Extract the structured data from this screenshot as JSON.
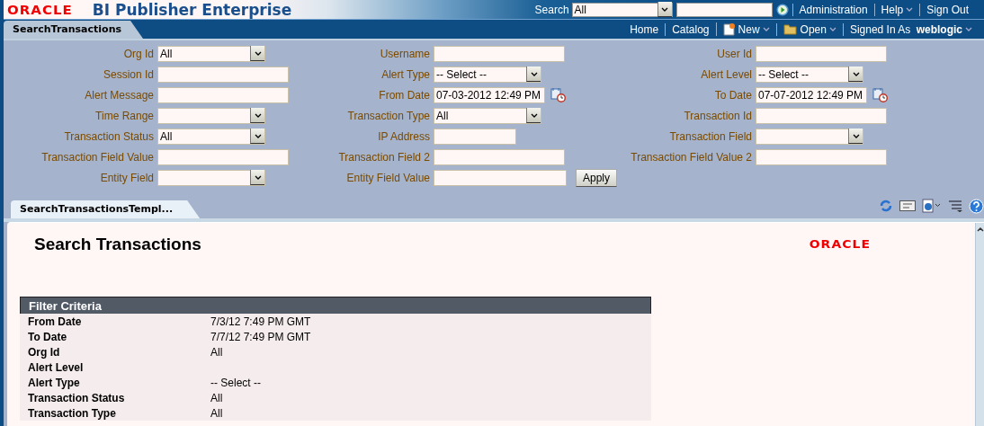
{
  "header": {
    "logo": "ORACLE",
    "product": "BI Publisher Enterprise",
    "search": {
      "label": "Search",
      "scope": "All"
    },
    "links": [
      {
        "label": "Administration",
        "menu": false
      },
      {
        "label": "Help",
        "menu": true
      },
      {
        "label": "Sign Out",
        "menu": false
      }
    ]
  },
  "nav": {
    "tab": {
      "label": "SearchTransactions",
      "selected": true
    },
    "links": [
      {
        "label": "Home",
        "kind": "link"
      },
      {
        "label": "Catalog",
        "kind": "link"
      },
      {
        "label": "New",
        "kind": "new"
      },
      {
        "label": "Open",
        "kind": "open"
      }
    ],
    "signed_in": {
      "label": "Signed In As",
      "user": "weblogic"
    }
  },
  "form": {
    "fields": [
      {
        "label": "Org Id",
        "kind": "select",
        "value": "All"
      },
      {
        "label": "Username",
        "kind": "text"
      },
      {
        "label": "User Id",
        "kind": "text"
      },
      {
        "label": "Session Id",
        "kind": "text"
      },
      {
        "label": "Alert Type",
        "kind": "select",
        "value": "-- Select --"
      },
      {
        "label": "Alert Level",
        "kind": "select",
        "value": "-- Select --"
      },
      {
        "label": "Alert Message",
        "kind": "text"
      },
      {
        "label": "From Date",
        "kind": "date",
        "value": "07-03-2012 12:49 PM"
      },
      {
        "label": "To Date",
        "kind": "date",
        "value": "07-07-2012 12:49 PM"
      },
      {
        "label": "Time Range",
        "kind": "select"
      },
      {
        "label": "Transaction Type",
        "kind": "select",
        "value": "All"
      },
      {
        "label": "Transaction Id",
        "kind": "text"
      },
      {
        "label": "Transaction Status",
        "kind": "select",
        "value": "All"
      },
      {
        "label": "IP Address",
        "kind": "short"
      },
      {
        "label": "Transaction Field",
        "kind": "select"
      },
      {
        "label": "Transaction Field Value",
        "kind": "text"
      },
      {
        "label": "Transaction Field 2",
        "kind": "text"
      },
      {
        "label": "Transaction Field Value 2",
        "kind": "text"
      },
      {
        "label": "Entity Field",
        "kind": "select"
      },
      {
        "label": "Entity Field Value",
        "kind": "text"
      }
    ],
    "apply": "Apply"
  },
  "report": {
    "tab": {
      "label": "SearchTransactionsTempl...",
      "selected": true
    },
    "title": "Search Transactions",
    "logo": "ORACLE",
    "filter": {
      "title": "Filter Criteria",
      "rows": [
        {
          "label": "From Date",
          "value": "7/3/12 7:49 PM GMT"
        },
        {
          "label": "To Date",
          "value": "7/7/12 7:49 PM GMT"
        },
        {
          "label": "Org Id",
          "value": "All"
        },
        {
          "label": "Alert Level"
        },
        {
          "label": "Alert Type",
          "value": "-- Select --"
        },
        {
          "label": "Transaction Status",
          "value": "All"
        },
        {
          "label": "Transaction Type",
          "value": "All"
        }
      ]
    }
  }
}
